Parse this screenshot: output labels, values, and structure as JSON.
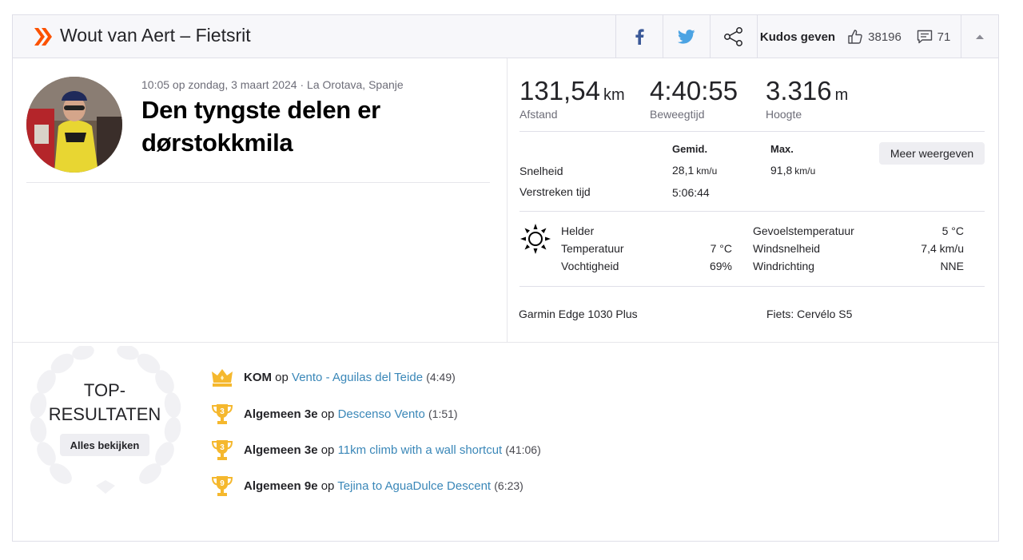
{
  "header": {
    "title": "Wout van Aert – Fietsrit",
    "kudos_label": "Kudos geven",
    "kudos_count": "38196",
    "comment_count": "71",
    "icons": [
      "strava-logo-icon",
      "facebook-icon",
      "twitter-icon",
      "share-icon",
      "thumbs-up-icon",
      "comment-icon",
      "chevron-up-icon"
    ]
  },
  "activity": {
    "meta": "10:05 op zondag, 3 maart 2024 · La Orotava, Spanje",
    "name": "Den tyngste delen er dørstokkmila"
  },
  "stats": {
    "distance": {
      "value": "131,54",
      "unit": "km",
      "label": "Afstand"
    },
    "moving_time": {
      "value": "4:40:55",
      "label": "Beweegtijd"
    },
    "elevation": {
      "value": "3.316",
      "unit": "m",
      "label": "Hoogte"
    }
  },
  "more_stats": {
    "col_avg": "Gemid.",
    "col_max": "Max.",
    "more_button": "Meer weergeven",
    "speed_label": "Snelheid",
    "speed_avg": "28,1",
    "speed_max": "91,8",
    "speed_unit": "km/u",
    "elapsed_label": "Verstreken tijd",
    "elapsed_value": "5:06:44"
  },
  "weather": {
    "condition": "Helder",
    "temp_label": "Temperatuur",
    "temp_value": "7 °C",
    "humidity_label": "Vochtigheid",
    "humidity_value": "69%",
    "feels_label": "Gevoelstemperatuur",
    "feels_value": "5 °C",
    "wind_speed_label": "Windsnelheid",
    "wind_speed_value": "7,4 km/u",
    "wind_dir_label": "Windrichting",
    "wind_dir_value": "NNE"
  },
  "gear": {
    "device": "Garmin Edge 1030 Plus",
    "bike": "Fiets: Cervélo S5"
  },
  "top_results": {
    "title_line1": "TOP-",
    "title_line2": "RESULTATEN",
    "all_button": "Alles bekijken",
    "items": [
      {
        "rank": "KOM",
        "sep": " op ",
        "segment": "Vento - Aguilas del Teide",
        "time": "(4:49)",
        "badge": ""
      },
      {
        "rank": "Algemeen 3e",
        "sep": " op ",
        "segment": "Descenso Vento",
        "time": "(1:51)",
        "badge": "3"
      },
      {
        "rank": "Algemeen 3e",
        "sep": " op ",
        "segment": "11km climb with a wall shortcut",
        "time": "(41:06)",
        "badge": "3"
      },
      {
        "rank": "Algemeen 9e",
        "sep": " op ",
        "segment": "Tejina to AguaDulce Descent",
        "time": "(6:23)",
        "badge": "9"
      }
    ]
  },
  "colors": {
    "strava_orange": "#fc5200",
    "link": "#3a87b8",
    "facebook": "#3b5998",
    "twitter": "#4ba3e3",
    "trophy": "#f5b82e"
  }
}
